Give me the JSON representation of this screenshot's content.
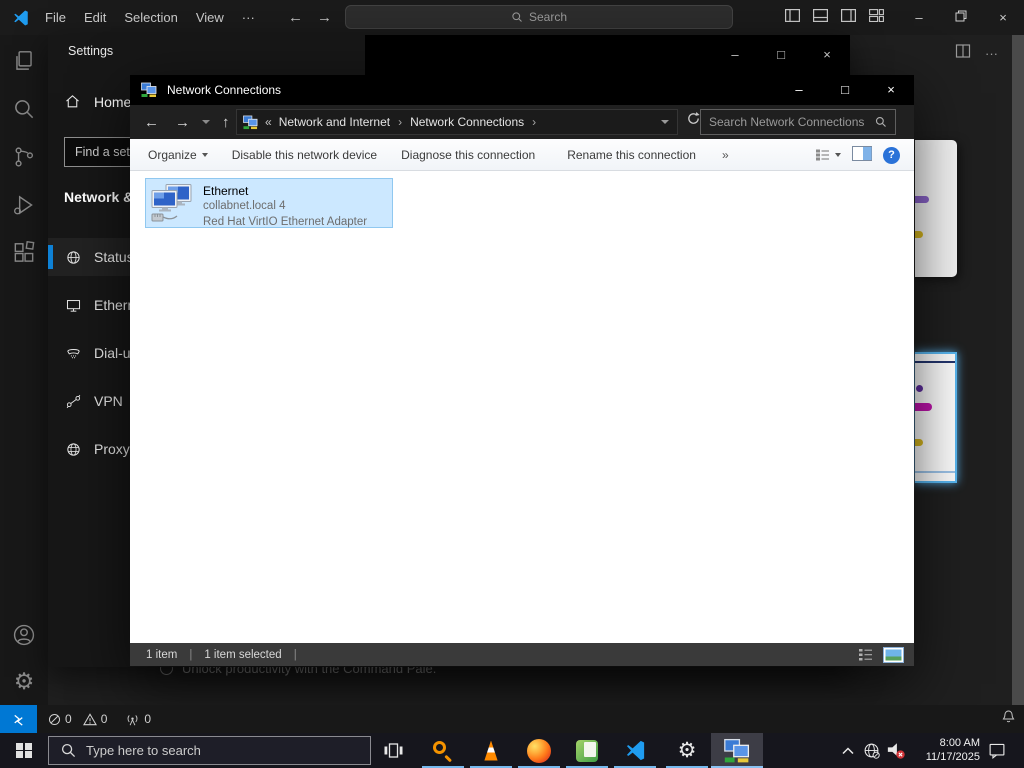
{
  "vscode": {
    "menu_items": [
      "File",
      "Edit",
      "Selection",
      "View",
      "···"
    ],
    "command_center_placeholder": "Search",
    "editor_more": "···",
    "welcome_hint": "Unlock productivity with the Command Pale.",
    "status_bar": {
      "errors": "0",
      "warnings": "0",
      "broadcast": "0"
    }
  },
  "settings_app": {
    "window_title": "Settings",
    "home_label": "Home",
    "search_placeholder": "Find a setting",
    "section_heading": "Network & Internet",
    "accent_color": "#0f82d6",
    "nav_items": [
      {
        "label": "Status",
        "icon": "globe-icon",
        "selected": true
      },
      {
        "label": "Ethernet",
        "icon": "monitor-icon",
        "selected": false
      },
      {
        "label": "Dial-up",
        "icon": "phone-icon",
        "selected": false
      },
      {
        "label": "VPN",
        "icon": "vpn-icon",
        "selected": false
      },
      {
        "label": "Proxy",
        "icon": "globe-icon",
        "selected": false
      }
    ]
  },
  "explorer": {
    "window_title": "Network Connections",
    "breadcrumb": {
      "prefix": "«",
      "crumb1": "Network and Internet",
      "separator1": "›",
      "crumb2": "Network Connections",
      "separator2": "›"
    },
    "search_placeholder": "Search Network Connections",
    "toolbar": [
      "Organize",
      "Disable this network device",
      "Diagnose this connection",
      "Rename this connection",
      "»"
    ],
    "item": {
      "name": "Ethernet",
      "domain": "collabnet.local 4",
      "device": "Red Hat VirtIO Ethernet Adapter"
    },
    "status_bar": {
      "count": "1 item",
      "selected": "1 item selected",
      "separator": "|"
    },
    "selection_color": "#cce8ff"
  },
  "taskbar": {
    "search_placeholder": "Type here to search",
    "clock": {
      "time": "8:00 AM",
      "date": "11/17/2025"
    }
  }
}
